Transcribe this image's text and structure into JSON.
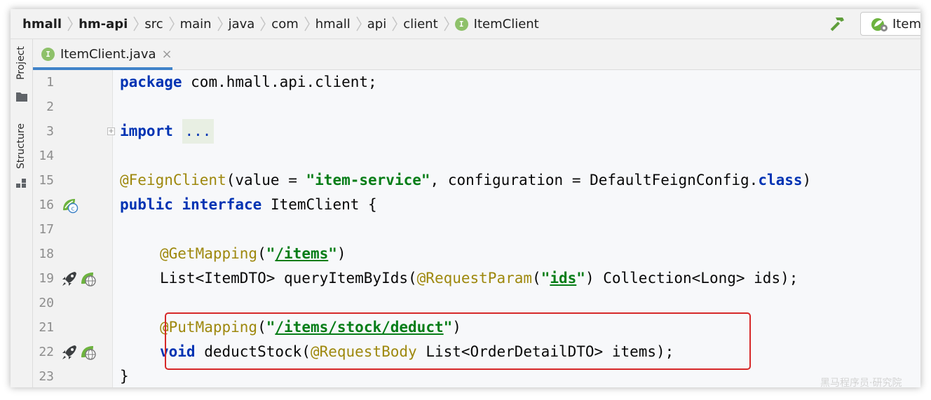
{
  "breadcrumb": [
    "hmall",
    "hm-api",
    "src",
    "main",
    "java",
    "com",
    "hmall",
    "api",
    "client",
    "ItemClient"
  ],
  "interface_badge": "I",
  "run_config": {
    "label": "ItemA"
  },
  "tool_windows": {
    "project": "Project",
    "structure": "Structure"
  },
  "tab": {
    "name": "ItemClient.java",
    "close": "×"
  },
  "editor": {
    "lines": [
      {
        "n": "1"
      },
      {
        "n": "2"
      },
      {
        "n": "3"
      },
      {
        "n": "14"
      },
      {
        "n": "15"
      },
      {
        "n": "16"
      },
      {
        "n": "17"
      },
      {
        "n": "18"
      },
      {
        "n": "19"
      },
      {
        "n": "20"
      },
      {
        "n": "21"
      },
      {
        "n": "22"
      },
      {
        "n": "23"
      }
    ],
    "fold_marker": "+",
    "code": {
      "kw_package": "package",
      "package_name": " com.hmall.api.client;",
      "kw_import": "import",
      "import_folded": "...",
      "feign_ann": "@FeignClient",
      "feign_open": "(value = ",
      "feign_value": "\"item-service\"",
      "feign_mid": ", configuration = DefaultFeignConfig.",
      "kw_class": "class",
      "feign_close": ")",
      "kw_public": "public",
      "kw_interface": "interface",
      "iface_name": " ItemClient {",
      "get_ann": "@GetMapping",
      "get_path": "/items",
      "list_decl": "List<ItemDTO> queryItemByIds(",
      "reqparam_ann": "@RequestParam",
      "reqparam_value": "ids",
      "list_tail": ") Collection<Long> ids);",
      "put_ann": "@PutMapping",
      "put_path": "/items/stock/deduct",
      "kw_void": "void",
      "deduct_decl": " deductStock(",
      "reqbody_ann": "@RequestBody",
      "deduct_tail": " List<OrderDetailDTO> items);",
      "closing": "}"
    }
  },
  "watermark": "黑马程序员·研究院",
  "colors": {
    "keyword": "#0033b3",
    "annotation": "#9e880d",
    "string": "#067d17",
    "highlight": "#d62828",
    "tab_underline": "#4083c9",
    "spring_green": "#6db33f"
  }
}
